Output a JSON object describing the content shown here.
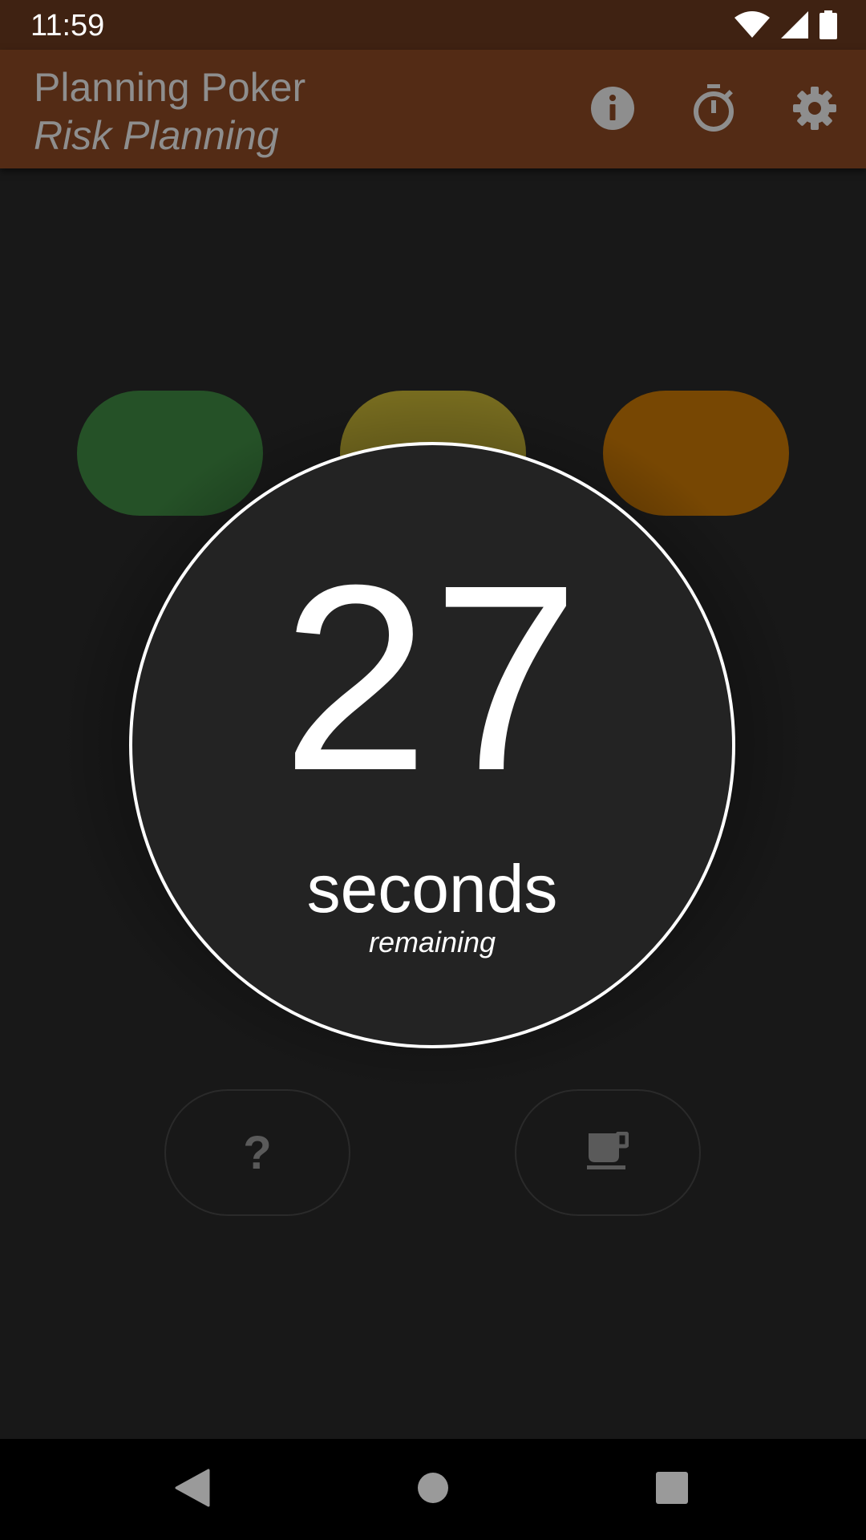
{
  "status_bar": {
    "time": "11:59",
    "icons": [
      "wifi-icon",
      "signal-icon",
      "battery-icon"
    ]
  },
  "app_bar": {
    "title": "Planning Poker",
    "subtitle": "Risk Planning",
    "actions": [
      "info-icon",
      "timer-icon",
      "settings-icon"
    ]
  },
  "cards": {
    "colors": [
      "#255127",
      "#766b1f",
      "#774703"
    ]
  },
  "timer": {
    "value": "27",
    "unit": "seconds",
    "caption": "remaining"
  },
  "buttons": {
    "question_label": "?",
    "coffee_icon": "coffee-icon"
  },
  "nav_bar": {
    "icons": [
      "back-icon",
      "home-icon",
      "recents-icon"
    ]
  }
}
